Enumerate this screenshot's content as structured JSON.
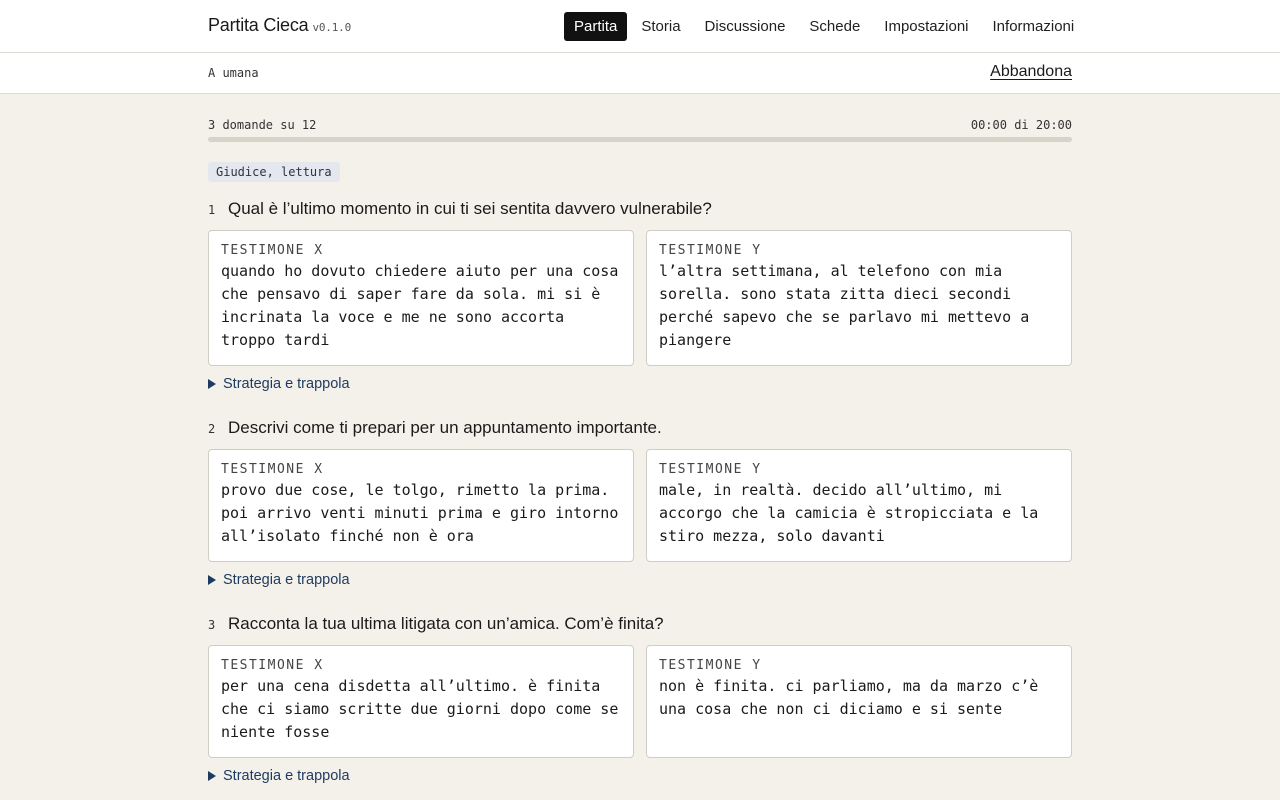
{
  "app": {
    "name": "Partita Cieca",
    "version": "v0.1.0"
  },
  "nav": {
    "items": [
      {
        "label": "Partita",
        "active": true
      },
      {
        "label": "Storia",
        "active": false
      },
      {
        "label": "Discussione",
        "active": false
      },
      {
        "label": "Schede",
        "active": false
      },
      {
        "label": "Impostazioni",
        "active": false
      },
      {
        "label": "Informazioni",
        "active": false
      }
    ]
  },
  "subbar": {
    "mode": "A umana",
    "quit_label": "Abbandona"
  },
  "progress": {
    "questions_text": "3 domande su 12",
    "timer_text": "00:00 di 20:00",
    "fraction": 0
  },
  "role_chip": "Giudice, lettura",
  "questions": [
    {
      "num": "1",
      "title": "Qual è l’ultimo momento in cui ti sei sentita davvero vulnerabile?",
      "x_label": "TESTIMONE X",
      "x_text": "quando ho dovuto chiedere aiuto per una cosa che pensavo di saper fare da sola. mi si è incrinata la voce e me ne sono accorta troppo tardi",
      "y_label": "TESTIMONE Y",
      "y_text": "l’altra settimana, al telefono con mia sorella. sono stata zitta dieci secondi perché sapevo che se parlavo mi mettevo a piangere",
      "strategy_label": "Strategia e trappola"
    },
    {
      "num": "2",
      "title": "Descrivi come ti prepari per un appuntamento importante.",
      "x_label": "TESTIMONE X",
      "x_text": "provo due cose, le tolgo, rimetto la prima. poi arrivo venti minuti prima e giro intorno all’isolato finché non è ora",
      "y_label": "TESTIMONE Y",
      "y_text": "male, in realtà. decido all’ultimo, mi accorgo che la camicia è stropicciata e la stiro mezza, solo davanti",
      "strategy_label": "Strategia e trappola"
    },
    {
      "num": "3",
      "title": "Racconta la tua ultima litigata con un’amica. Com’è finita?",
      "x_label": "TESTIMONE X",
      "x_text": "per una cena disdetta all’ultimo. è finita che ci siamo scritte due giorni dopo come se niente fosse",
      "y_label": "TESTIMONE Y",
      "y_text": "non è finita. ci parliamo, ma da marzo c’è una cosa che non ci diciamo e si sente",
      "strategy_label": "Strategia e trappola"
    }
  ]
}
